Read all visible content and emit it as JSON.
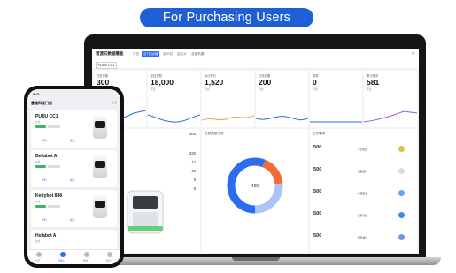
{
  "header": {
    "badge": "For Purchasing Users"
  },
  "dashboard": {
    "title": "普渡云数据看板",
    "tabs": [
      "今日",
      "近7日运营",
      "近30日",
      "自定义",
      "全部机器"
    ],
    "store_select": "PUDU CC1",
    "metrics": [
      {
        "label": "任务总数",
        "value": "300",
        "sub": "昨日"
      },
      {
        "label": "配送里程",
        "value": "18,000",
        "sub": "环比"
      },
      {
        "label": "运行时长",
        "value": "1,520",
        "sub": "环比"
      },
      {
        "label": "在线机器",
        "value": "200",
        "sub": "环比"
      },
      {
        "label": "故障",
        "value": "0",
        "sub": "环比"
      },
      {
        "label": "累计服务",
        "value": "581",
        "sub": "环比"
      }
    ],
    "left_values": [
      "400",
      "330",
      "12",
      "48",
      "5",
      "5"
    ],
    "donut": {
      "title": "任务类型分布",
      "center": "400"
    },
    "events": {
      "title": "工作事件",
      "items": [
        {
          "value": "500",
          "desc": "今日配送"
        },
        {
          "value": "500",
          "desc": "机器运行"
        },
        {
          "value": "500",
          "desc": "地图更新"
        },
        {
          "value": "500",
          "desc": "任务完成"
        },
        {
          "value": "500",
          "desc": "服务统计"
        }
      ]
    }
  },
  "phone": {
    "time": "9:41",
    "store": "普渡科技门店",
    "more": "更多",
    "robots": [
      {
        "name": "PUDU CC1",
        "sub": "在线"
      },
      {
        "name": "Bellabot A",
        "sub": "在线"
      },
      {
        "name": "Kettybot 888",
        "sub": "在线"
      },
      {
        "name": "Holabot A",
        "sub": "在线"
      }
    ],
    "actions": [
      "呼叫",
      "任务"
    ],
    "nav": [
      "首页",
      "机器人",
      "数据",
      "我的"
    ]
  }
}
